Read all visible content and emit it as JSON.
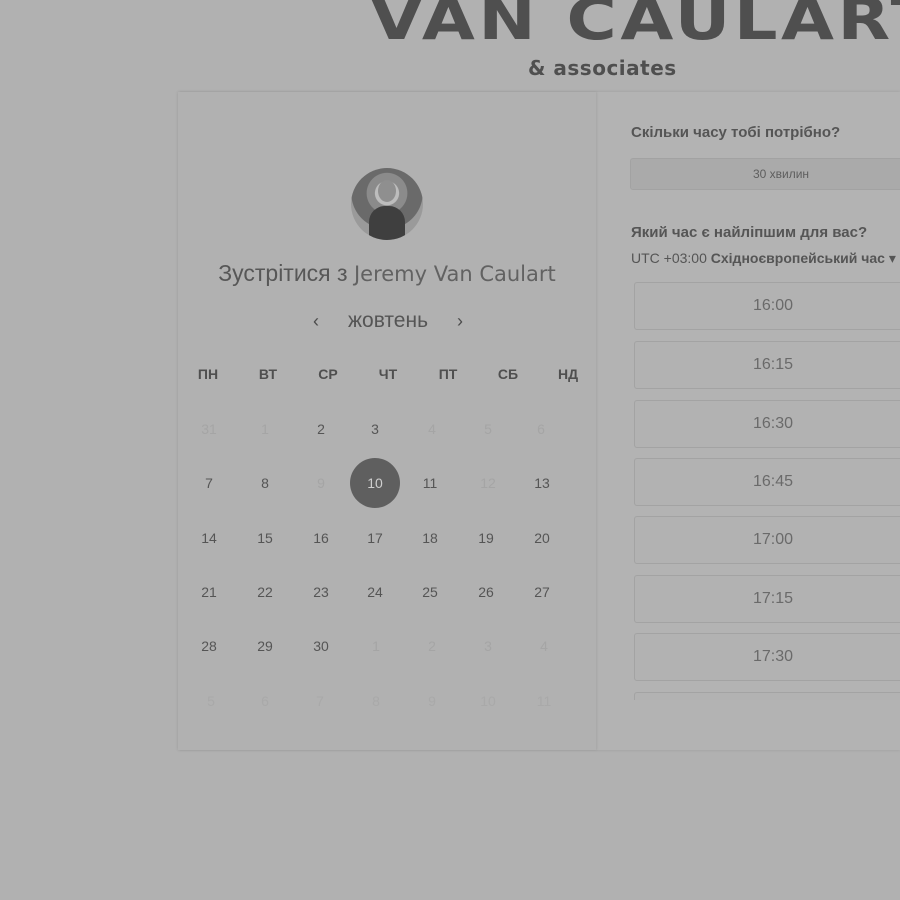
{
  "brand": {
    "title": "VAN CAULART",
    "subtitle": "& associates"
  },
  "host": {
    "prefix": "Зустрітися з",
    "name": "Jeremy Van Caulart"
  },
  "calendar": {
    "month": "жовтень",
    "prev_icon": "‹",
    "next_icon": "›",
    "weekdays": [
      "ПН",
      "ВТ",
      "СР",
      "ЧТ",
      "ПТ",
      "СБ",
      "НД"
    ],
    "weeks": [
      [
        "31",
        "1",
        "2",
        "3",
        "4",
        "5",
        "6"
      ],
      [
        "7",
        "8",
        "9",
        "10",
        "11",
        "12",
        "13"
      ],
      [
        "14",
        "15",
        "16",
        "17",
        "18",
        "19",
        "20"
      ],
      [
        "21",
        "22",
        "23",
        "24",
        "25",
        "26",
        "27"
      ],
      [
        "28",
        "29",
        "30",
        "1",
        "2",
        "3",
        "4"
      ],
      [
        "5",
        "6",
        "7",
        "8",
        "9",
        "10",
        "11"
      ]
    ],
    "selected": "10"
  },
  "duration": {
    "question": "Скільки часу тобі потрібно?",
    "value": "30 хвилин"
  },
  "time": {
    "question": "Який час є найліпшим для вас?",
    "tz_offset": "UTC +03:00",
    "tz_name": "Східноєвропейський час",
    "tz_caret": "▾",
    "slots": [
      "16:00",
      "16:15",
      "16:30",
      "16:45",
      "17:00",
      "17:15",
      "17:30"
    ]
  }
}
